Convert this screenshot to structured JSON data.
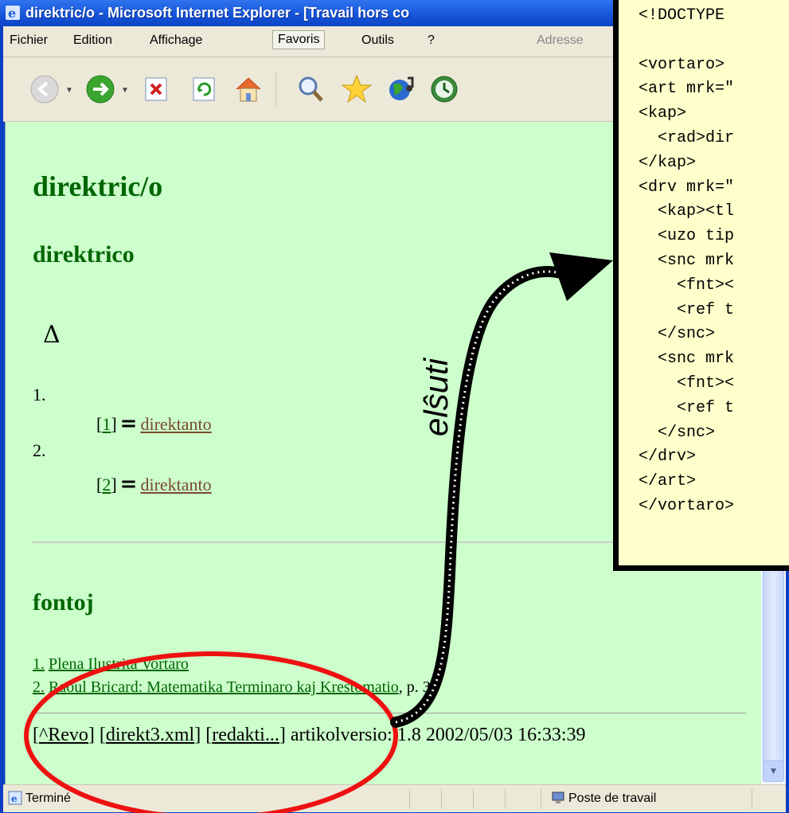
{
  "window": {
    "title": "direktric/o - Microsoft Internet Explorer - [Travail hors co"
  },
  "menubar": {
    "items": [
      {
        "label": "Fichier"
      },
      {
        "label": "Edition"
      },
      {
        "label": "Affichage"
      },
      {
        "label": "Favoris"
      },
      {
        "label": "Outils"
      },
      {
        "label": "?"
      }
    ],
    "address_label": "Adresse"
  },
  "toolbar": {
    "buttons": [
      {
        "icon": "back-arrow-icon"
      },
      {
        "icon": "forward-arrow-icon"
      },
      {
        "icon": "stop-icon"
      },
      {
        "icon": "refresh-icon"
      },
      {
        "icon": "home-icon"
      },
      {
        "icon": "search-icon"
      },
      {
        "icon": "favorites-star-icon"
      },
      {
        "icon": "media-icon"
      },
      {
        "icon": "history-icon"
      }
    ]
  },
  "page": {
    "title": "direktric/o",
    "subtitle": "direktrico",
    "symbol": "Δ",
    "senses": [
      {
        "number": "1.",
        "ref_num": "1",
        "eq": "=",
        "link": "direktanto"
      },
      {
        "number": "2.",
        "ref_num": "2",
        "eq": "=",
        "link": "direktanto"
      }
    ],
    "sources_heading": "fontoj",
    "sources": [
      {
        "num": "1.",
        "text": "Plena Ilustrita Vortaro",
        "suffix": ""
      },
      {
        "num": "2.",
        "text": "Raoul Bricard: Matematika Terminaro kaj Krestomatio",
        "suffix": ", p. 34"
      }
    ],
    "footer": {
      "revo": "^Revo",
      "xml": "direkt3.xml",
      "edit": "redakti...",
      "version": "artikolversio: 1.8 2002/05/03 16:33:39"
    }
  },
  "statusbar": {
    "text": "Terminé",
    "zone": "Poste de travail"
  },
  "xml_source": {
    "lines": [
      "<!DOCTYPE",
      "",
      "<vortaro>",
      "<art mrk=\"",
      "<kap>",
      "  <rad>dir",
      "</kap>",
      "<drv mrk=\"",
      "  <kap><tl",
      "  <uzo tip",
      "  <snc mrk",
      "    <fnt><",
      "    <ref t",
      "  </snc>",
      "  <snc mrk",
      "    <fnt><",
      "    <ref t",
      "  </snc>",
      "</drv>",
      "</art>",
      "</vortaro>"
    ]
  },
  "annotation": {
    "arrow_label": "elŝuti",
    "ellipse_color": "#ee1111",
    "arrow_color": "#000000"
  },
  "colors": {
    "page_bg": "#ccffcc",
    "heading": "#006600",
    "xml_bg": "#ffffcc",
    "titlebar": "#1553d8"
  }
}
